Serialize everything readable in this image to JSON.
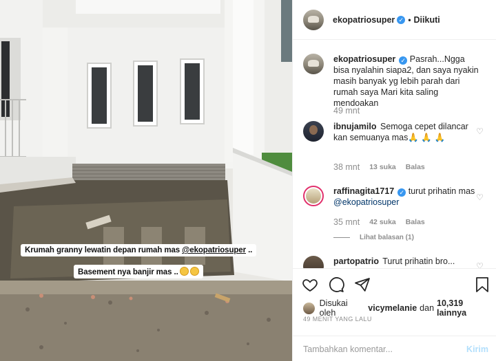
{
  "media": {
    "sticker_line1_prefix": "Krumah granny  lewatin depan rumah mas ",
    "sticker_line1_mention": "@ekopatriosuper",
    "sticker_line1_suffix": " ..",
    "sticker_line2": "Basement nya banjir mas .."
  },
  "header": {
    "username": "ekopatriosuper",
    "separator": "•",
    "follow_status": "Diikuti"
  },
  "caption": {
    "username": "ekopatriosuper",
    "text": "Pasrah...Ngga bisa nyalahin siapa2, dan saya nyakin masih banyak yg lebih parah dari rumah saya Mari kita saling mendoakan",
    "time": "49 mnt"
  },
  "comments": [
    {
      "username": "ibnujamilo",
      "text": "Semoga cepet dilancar kan semuanya mas🙏 🙏 🙏",
      "time": "38 mnt",
      "likes": "13 suka",
      "reply": "Balas"
    },
    {
      "username": "raffinagita1717",
      "text_prefix": "turut prihatin mas ",
      "mention": "@ekopatriosuper",
      "time": "35 mnt",
      "likes": "42 suka",
      "reply": "Balas",
      "view_replies": "Lihat balasan (1)"
    },
    {
      "username": "partopatrio",
      "text": "Turut prihatin bro..."
    }
  ],
  "likes": {
    "prefix": "Disukai oleh",
    "user": "vicymelanie",
    "middle": "dan",
    "count": "10,319 lainnya"
  },
  "timestamp": "49 MENIT YANG LALU",
  "composer": {
    "placeholder": "Tambahkan komentar...",
    "post_label": "Kirim"
  },
  "icons": [
    "heart-icon",
    "comment-icon",
    "share-icon",
    "bookmark-icon",
    "verified-badge-icon"
  ],
  "colors": {
    "verified": "#3897f0",
    "link": "#003569",
    "muted": "#8e8e8e",
    "post_disabled": "#b2dffc"
  }
}
